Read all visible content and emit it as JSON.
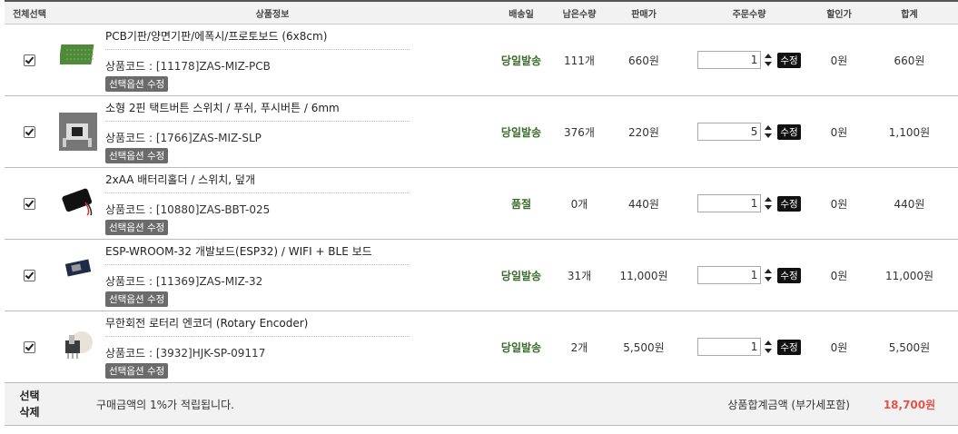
{
  "headers": {
    "select_all": "전체선택",
    "product_info": "상품정보",
    "ship_date": "배송일",
    "remaining": "남은수량",
    "price": "판매가",
    "order_qty": "주문수량",
    "discount": "할인가",
    "total": "합계"
  },
  "option_button_label": "선택옵션 수정",
  "edit_button_label": "수정",
  "items": [
    {
      "name": "PCB기판/양면기판/에폭시/프로토보드 (6x8cm)",
      "code": "상품코드 : [11178]ZAS-MIZ-PCB",
      "ship": "당일발송",
      "remaining": "111개",
      "price": "660원",
      "qty": "1",
      "discount": "0원",
      "total": "660원",
      "checked": true
    },
    {
      "name": "소형 2핀 택트버튼 스위치 / 푸쉬, 푸시버튼 / 6mm",
      "code": "상품코드 : [1766]ZAS-MIZ-SLP",
      "ship": "당일발송",
      "remaining": "376개",
      "price": "220원",
      "qty": "5",
      "discount": "0원",
      "total": "1,100원",
      "checked": true
    },
    {
      "name": "2xAA 배터리홀더 / 스위치, 덮개",
      "code": "상품코드 : [10880]ZAS-BBT-025",
      "ship": "품절",
      "remaining": "0개",
      "price": "440원",
      "qty": "1",
      "discount": "0원",
      "total": "440원",
      "checked": true
    },
    {
      "name": "ESP-WROOM-32 개발보드(ESP32) / WIFI + BLE 보드",
      "code": "상품코드 : [11369]ZAS-MIZ-32",
      "ship": "당일발송",
      "remaining": "31개",
      "price": "11,000원",
      "qty": "1",
      "discount": "0원",
      "total": "11,000원",
      "checked": true
    },
    {
      "name": "무한회전 로터리 엔코더 (Rotary Encoder)",
      "code": "상품코드 : [3932]HJK-SP-09117",
      "ship": "당일발송",
      "remaining": "2개",
      "price": "5,500원",
      "qty": "1",
      "discount": "0원",
      "total": "5,500원",
      "checked": true
    }
  ],
  "footer": {
    "delete_selected": "선택\n삭제",
    "notice": "구매금액의 1%가 적립됩니다.",
    "sum_label": "상품합계금액 (부가세포함)",
    "sum_value": "18,700원"
  },
  "colors": {
    "ship_text": "#3a6b2a",
    "sum_value": "#e0554a",
    "header_bg": "#f2f2f2"
  }
}
